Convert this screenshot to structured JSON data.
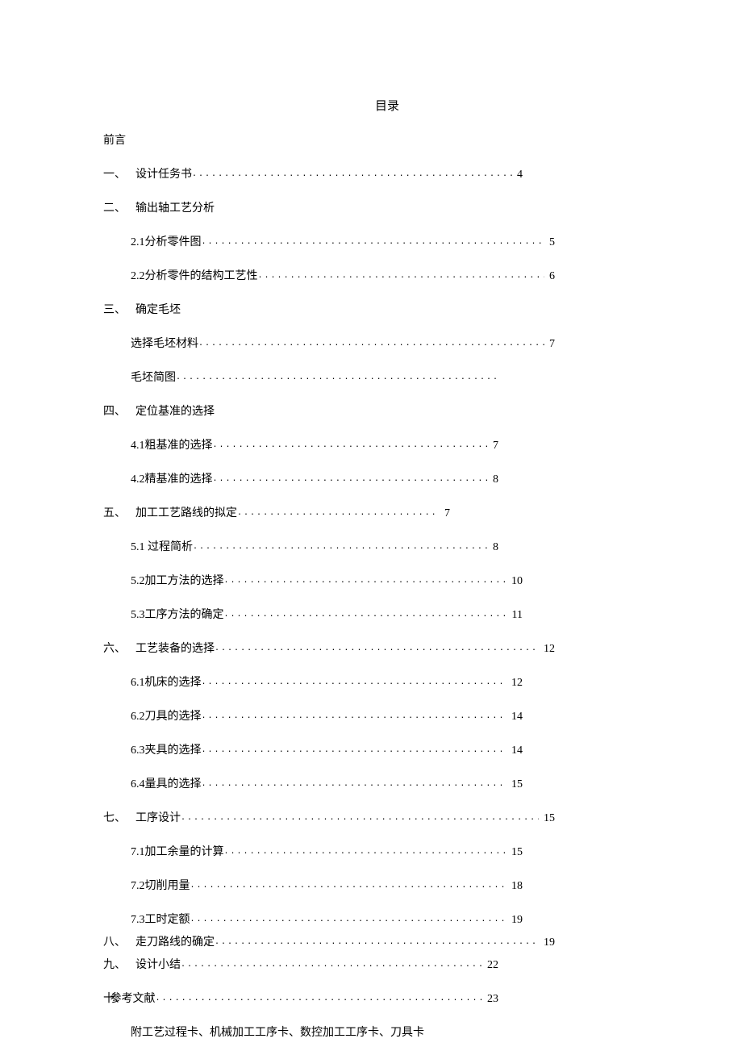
{
  "title": "目录",
  "preface": "前言",
  "items": {
    "s1": {
      "num": "一、",
      "label": "设计任务书",
      "page": "4"
    },
    "s2": {
      "num": "二、",
      "label": "输出轴工艺分析"
    },
    "s2_1": {
      "label": "2.1分析零件图",
      "page": "5"
    },
    "s2_2": {
      "label": "2.2分析零件的结构工艺性",
      "page": "6"
    },
    "s3": {
      "num": "三、",
      "label": "确定毛坯"
    },
    "s3_1": {
      "label": "选择毛坯材料",
      "page": "7"
    },
    "s3_2": {
      "label": "毛坯简图"
    },
    "s4": {
      "num": "四、",
      "label": "定位基准的选择"
    },
    "s4_1": {
      "label": "4.1粗基准的选择",
      "page": "7"
    },
    "s4_2": {
      "label": "4.2精基准的选择",
      "page": "8"
    },
    "s5": {
      "num": "五、",
      "label": "加工工艺路线的拟定",
      "page": "7"
    },
    "s5_1": {
      "label": "5.1 过程简析",
      "page": "8"
    },
    "s5_2": {
      "label": "5.2加工方法的选择",
      "page": "10"
    },
    "s5_3": {
      "label": "5.3工序方法的确定",
      "page": "11"
    },
    "s6": {
      "num": "六、",
      "label": "工艺装备的选择",
      "page": "12"
    },
    "s6_1": {
      "label": "6.1机床的选择",
      "page": "12"
    },
    "s6_2": {
      "label": "6.2刀具的选择",
      "page": "14"
    },
    "s6_3": {
      "label": "6.3夹具的选择",
      "page": "14"
    },
    "s6_4": {
      "label": "6.4量具的选择",
      "page": "15"
    },
    "s7": {
      "num": "七、",
      "label": "工序设计",
      "page": "15"
    },
    "s7_1": {
      "label": "7.1加工余量的计算",
      "page": "15"
    },
    "s7_2": {
      "label": "7.2切削用量",
      "page": "18"
    },
    "s7_3": {
      "label": "7.3工时定额",
      "page": "19"
    },
    "s8": {
      "num": "八、",
      "label": "走刀路线的确定",
      "page": "19"
    },
    "s9": {
      "num": "九、",
      "label": "设计小结",
      "page": "22"
    },
    "s10": {
      "num": "十、",
      "label": "参考文献",
      "page": "23"
    },
    "appendix": "附工艺过程卡、机械加工工序卡、数控加工工序卡、刀具卡"
  },
  "dots": "......................................................................................................................................................................"
}
